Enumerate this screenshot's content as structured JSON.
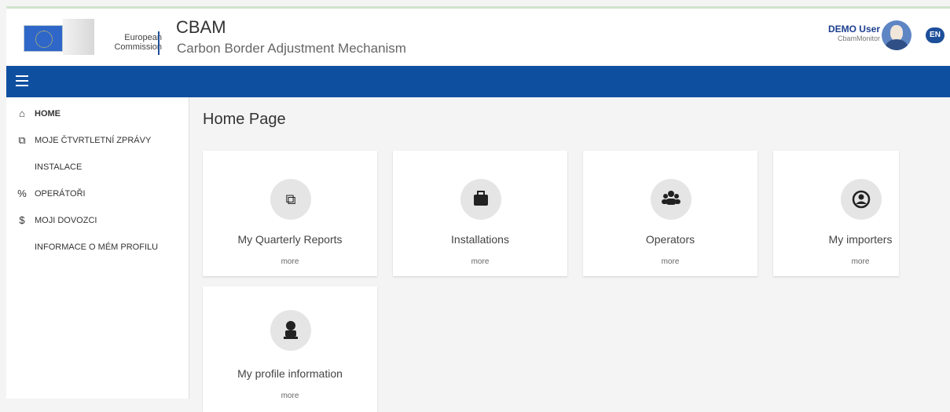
{
  "header": {
    "brand_line1": "European",
    "brand_line2": "Commission",
    "app_title": "CBAM",
    "app_subtitle": "Carbon Border Adjustment Mechanism",
    "user_name": "DEMO User",
    "user_role": "CbamMonitor",
    "language": "EN"
  },
  "sidebar": {
    "items": [
      {
        "label": "HOME",
        "icon": "home-icon"
      },
      {
        "label": "MOJE ČTVRTLETNÍ ZPRÁVY",
        "icon": "reports-icon"
      },
      {
        "label": "INSTALACE",
        "icon": ""
      },
      {
        "label": "OPERÁTOŘI",
        "icon": "percent-icon"
      },
      {
        "label": "MOJI DOVOZCI",
        "icon": "dollar-icon"
      },
      {
        "label": "INFORMACE O MÉM PROFILU",
        "icon": ""
      }
    ]
  },
  "main": {
    "page_title": "Home Page",
    "cards": [
      {
        "label": "My Quarterly Reports",
        "more": "more",
        "icon": "copy-icon"
      },
      {
        "label": "Installations",
        "more": "more",
        "icon": "briefcase-icon"
      },
      {
        "label": "Operators",
        "more": "more",
        "icon": "group-icon"
      },
      {
        "label": "My importers",
        "more": "more",
        "icon": "user-circle-icon"
      },
      {
        "label": "My profile information",
        "more": "more",
        "icon": "user-icon"
      }
    ]
  },
  "colors": {
    "navbar": "#0f4fa0",
    "brand_blue": "#1b3e8f"
  }
}
